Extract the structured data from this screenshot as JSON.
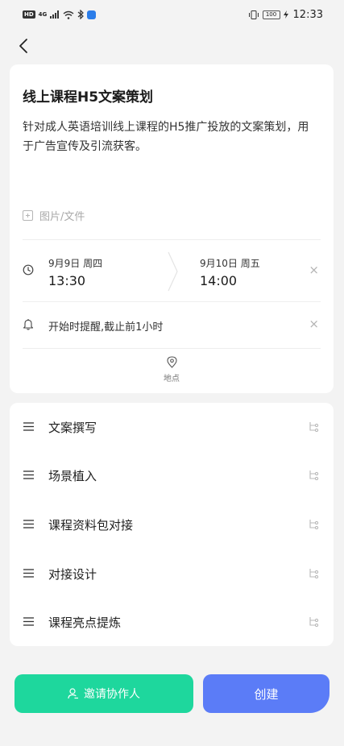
{
  "status_bar": {
    "hd": "HD",
    "network": "4G",
    "battery": "100",
    "time": "12:33"
  },
  "icons": {
    "back": "chevron-left-icon",
    "attach": "square-plus-icon",
    "clock": "clock-icon",
    "bell": "bell-icon",
    "location": "location-pin-icon",
    "menu": "menu-lines-icon",
    "branch": "subtask-branch-icon",
    "close": "close-icon",
    "user": "user-icon"
  },
  "task": {
    "title": "线上课程H5文案策划",
    "description": "针对成人英语培训线上课程的H5推广投放的文案策划，用于广告宣传及引流获客。",
    "attach_label": "图片/文件",
    "start": {
      "date": "9月9日 周四",
      "time": "13:30"
    },
    "end": {
      "date": "9月10日 周五",
      "time": "14:00"
    },
    "reminder": "开始时提醒,截止前1小时",
    "location_label": "地点",
    "close_symbol": "×"
  },
  "subtasks": [
    {
      "label": "文案撰写"
    },
    {
      "label": "场景植入"
    },
    {
      "label": "课程资料包对接"
    },
    {
      "label": "对接设计"
    },
    {
      "label": "课程亮点提炼"
    }
  ],
  "actions": {
    "invite_label": "邀请协作人",
    "create_label": "创建"
  },
  "colors": {
    "invite_green": "#1ed79d",
    "create_blue": "#5b7cf7",
    "background": "#f3f3f3"
  }
}
